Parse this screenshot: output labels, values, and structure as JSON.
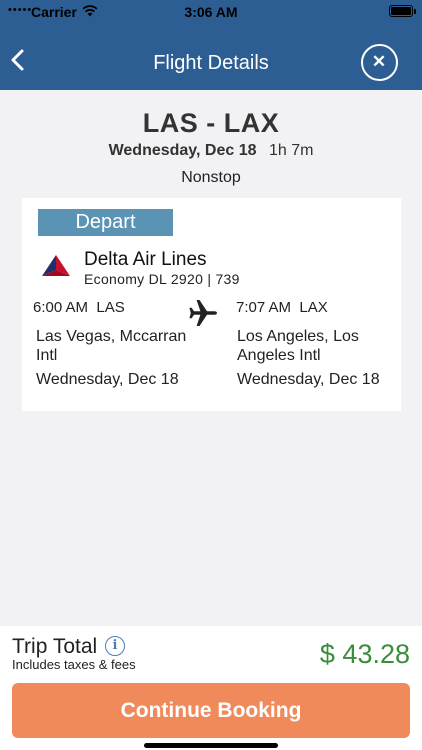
{
  "status_bar": {
    "carrier": "Carrier",
    "time": "3:06 AM"
  },
  "nav": {
    "title": "Flight Details",
    "back_icon": "chevron-left-icon",
    "close_icon": "close-circle-icon"
  },
  "summary": {
    "route": "LAS - LAX",
    "date": "Wednesday, Dec 18",
    "duration": "1h 7m",
    "stops": "Nonstop"
  },
  "leg": {
    "badge": "Depart",
    "airline": "Delta Air Lines",
    "fare": "Economy DL 2920 | 739",
    "departure": {
      "time": "6:00 AM",
      "code": "LAS",
      "airport": "Las Vegas, Mccarran Intl",
      "date": "Wednesday, Dec 18"
    },
    "arrival": {
      "time": "7:07 AM",
      "code": "LAX",
      "airport": "Los Angeles, Los Angeles Intl",
      "date": "Wednesday, Dec 18"
    }
  },
  "footer": {
    "total_label": "Trip Total",
    "total_note": "Includes taxes & fees",
    "price": "$ 43.28",
    "cta": "Continue Booking"
  },
  "colors": {
    "nav_bar": "#2c5e93",
    "badge": "#5b93b5",
    "price": "#3a8d3a",
    "cta": "#f08a5a"
  }
}
